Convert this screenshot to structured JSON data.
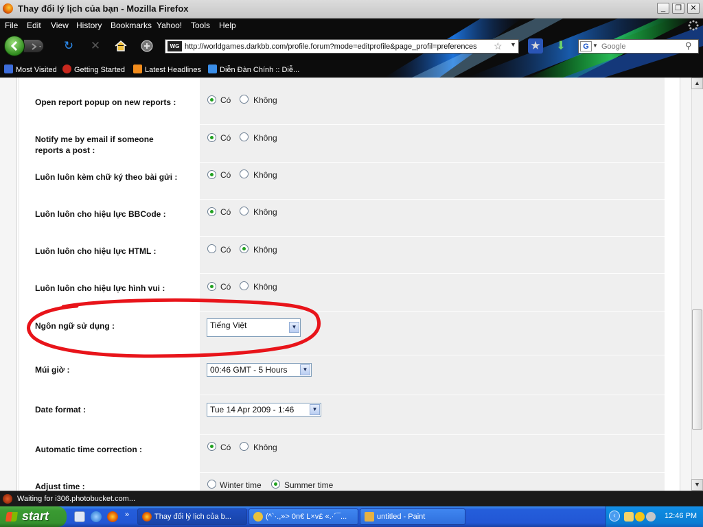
{
  "window": {
    "title": "Thay đổi lý lịch của bạn - Mozilla Firefox",
    "controls": {
      "minimize": "_",
      "maximize": "❐",
      "close": "✕"
    }
  },
  "menu": [
    "File",
    "Edit",
    "View",
    "History",
    "Bookmarks",
    "Yahoo!",
    "Tools",
    "Help"
  ],
  "navbar": {
    "url": "http://worldgames.darkbb.com/profile.forum?mode=editprofile&page_profil=preferences",
    "site_icon": "WG",
    "search_placeholder": "Google",
    "search_engine_icon": "G"
  },
  "bookmarks": [
    "Most Visited",
    "Getting Started",
    "Latest Headlines",
    "Diễn Đàn Chính :: Diễ..."
  ],
  "form": {
    "yes": "Có",
    "no": "Không",
    "rows": [
      {
        "label": "Open report popup on new reports :",
        "type": "radio",
        "selected": "yes"
      },
      {
        "label": "Notify me by email if someone reports a post :",
        "type": "radio",
        "selected": "yes"
      },
      {
        "label": "Luôn luôn kèm chữ ký theo bài gửi :",
        "type": "radio",
        "selected": "yes"
      },
      {
        "label": "Luôn luôn cho hiệu lực BBCode :",
        "type": "radio",
        "selected": "yes"
      },
      {
        "label": "Luôn luôn cho hiệu lực HTML :",
        "type": "radio",
        "selected": "no"
      },
      {
        "label": "Luôn luôn cho hiệu lực hình vui :",
        "type": "radio",
        "selected": "yes"
      },
      {
        "label": "Ngôn ngữ sử dụng :",
        "type": "select",
        "value": "Tiếng Việt"
      },
      {
        "label": "Múi giờ :",
        "type": "select",
        "value": "00:46 GMT - 5 Hours"
      },
      {
        "label": "Date format :",
        "type": "select",
        "value": "Tue 14 Apr 2009 - 1:46"
      },
      {
        "label": "Automatic time correction :",
        "type": "radio",
        "selected": "yes"
      },
      {
        "label": "Adjust time :",
        "type": "radio2",
        "options": [
          "Winter time",
          "Summer time"
        ],
        "selected": "Summer time"
      }
    ]
  },
  "annotation": {
    "color": "#e8141a",
    "shape": "hand-drawn-ellipse",
    "target": "Ngôn ngữ sử dụng"
  },
  "status": "Waiting for i306.photobucket.com...",
  "taskbar": {
    "start": "start",
    "tasks": [
      "Thay đổi lý lịch của b...",
      "(^`·.,»> 0n€ L×v£ «.·´¯...",
      "untitled - Paint"
    ],
    "clock": "12:46 PM"
  },
  "colors": {
    "value_bg": "#efefef",
    "chrome_bg": "#0c0c0c",
    "taskbar": "#245edb",
    "start": "#3a9a32",
    "accent": "#21a121"
  }
}
